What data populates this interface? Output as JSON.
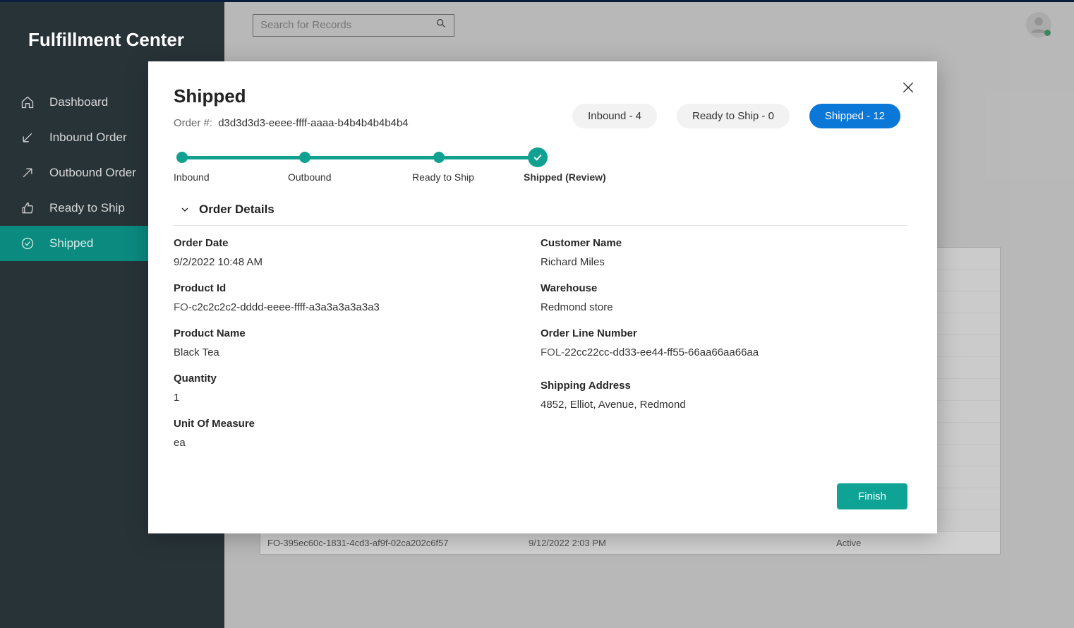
{
  "app_title": "Fulfillment Center",
  "search_placeholder": "Search for Records",
  "sidebar": {
    "items": [
      {
        "label": "Dashboard"
      },
      {
        "label": "Inbound Order"
      },
      {
        "label": "Outbound Order"
      },
      {
        "label": "Ready to Ship"
      },
      {
        "label": "Shipped"
      }
    ]
  },
  "bg_row": {
    "id": "FO-395ec60c-1831-4cd3-af9f-02ca202c6f57",
    "date": "9/12/2022 2:03 PM",
    "status": "Active"
  },
  "modal": {
    "title": "Shipped",
    "order_label": "Order #:",
    "order_num": "d3d3d3d3-eeee-ffff-aaaa-b4b4b4b4b4b4",
    "pills": [
      {
        "label": "Inbound - 4"
      },
      {
        "label": "Ready to Ship - 0"
      },
      {
        "label": "Shipped - 12"
      }
    ],
    "steps": [
      {
        "label": "Inbound"
      },
      {
        "label": "Outbound"
      },
      {
        "label": "Ready to Ship"
      },
      {
        "label": "Shipped (Review)"
      }
    ],
    "section": "Order Details",
    "left": {
      "order_date_k": "Order Date",
      "order_date_v": "9/2/2022 10:48 AM",
      "product_id_k": "Product Id",
      "product_id_prefix": "FO-",
      "product_id_v": "c2c2c2c2-dddd-eeee-ffff-a3a3a3a3a3a3",
      "product_name_k": "Product Name",
      "product_name_v": "Black Tea",
      "qty_k": "Quantity",
      "qty_v": "1",
      "uom_k": "Unit Of Measure",
      "uom_v": "ea"
    },
    "right": {
      "cust_k": "Customer Name",
      "cust_v": "Richard Miles",
      "wh_k": "Warehouse",
      "wh_v": "Redmond store",
      "oln_k": "Order Line Number",
      "oln_prefix": "FOL-",
      "oln_v": "22cc22cc-dd33-ee44-ff55-66aa66aa66aa",
      "addr_k": "Shipping Address",
      "addr_v": "4852, Elliot, Avenue, Redmond"
    },
    "finish": "Finish"
  }
}
